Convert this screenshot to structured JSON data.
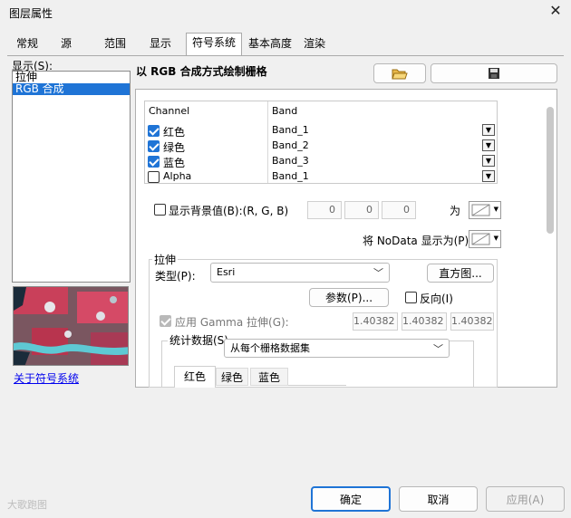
{
  "window": {
    "title": "图层属性",
    "close_icon": "close-icon"
  },
  "tabs": [
    {
      "label": "常规"
    },
    {
      "label": "源"
    },
    {
      "label": "范围"
    },
    {
      "label": "显示"
    },
    {
      "label": "符号系统"
    },
    {
      "label": "基本高度"
    },
    {
      "label": "渲染"
    }
  ],
  "left": {
    "show_label": "显示(S):",
    "items": [
      "拉伸",
      "RGB 合成"
    ],
    "selected": "RGB 合成",
    "link": "关于符号系统"
  },
  "main": {
    "heading": "以 RGB 合成方式绘制栅格",
    "open_icon": "folder-open-icon",
    "save_icon": "save-icon",
    "grid": {
      "headers": [
        "Channel",
        "Band"
      ],
      "rows": [
        {
          "channel": "红色",
          "band": "Band_1",
          "checked": true
        },
        {
          "channel": "绿色",
          "band": "Band_2",
          "checked": true
        },
        {
          "channel": "蓝色",
          "band": "Band_3",
          "checked": true
        },
        {
          "channel": "Alpha",
          "band": "Band_1",
          "checked": false
        }
      ]
    },
    "background": {
      "label": "显示背景值(B):(R, G, B)",
      "values": [
        "0",
        "0",
        "0"
      ],
      "as_label": "为"
    },
    "nodata": {
      "label": "将 NoData 显示为(P)"
    },
    "stretch": {
      "group_label": "拉伸",
      "type_label": "类型(P):",
      "type_value": "Esri",
      "histogram_btn": "直方图...",
      "params_btn": "参数(P)...",
      "invert_label": "反向(I)",
      "gamma_label": "应用 Gamma 拉伸(G):",
      "gamma_values": [
        "1.40382",
        "1.40382",
        "1.40382"
      ]
    },
    "stats": {
      "label": "统计数据(S)",
      "value": "从每个栅格数据集",
      "tabs": [
        "红色",
        "绿色",
        "蓝色"
      ]
    }
  },
  "footer": {
    "ok": "确定",
    "cancel": "取消",
    "apply": "应用(A)",
    "watermark": "大歌跑图"
  }
}
